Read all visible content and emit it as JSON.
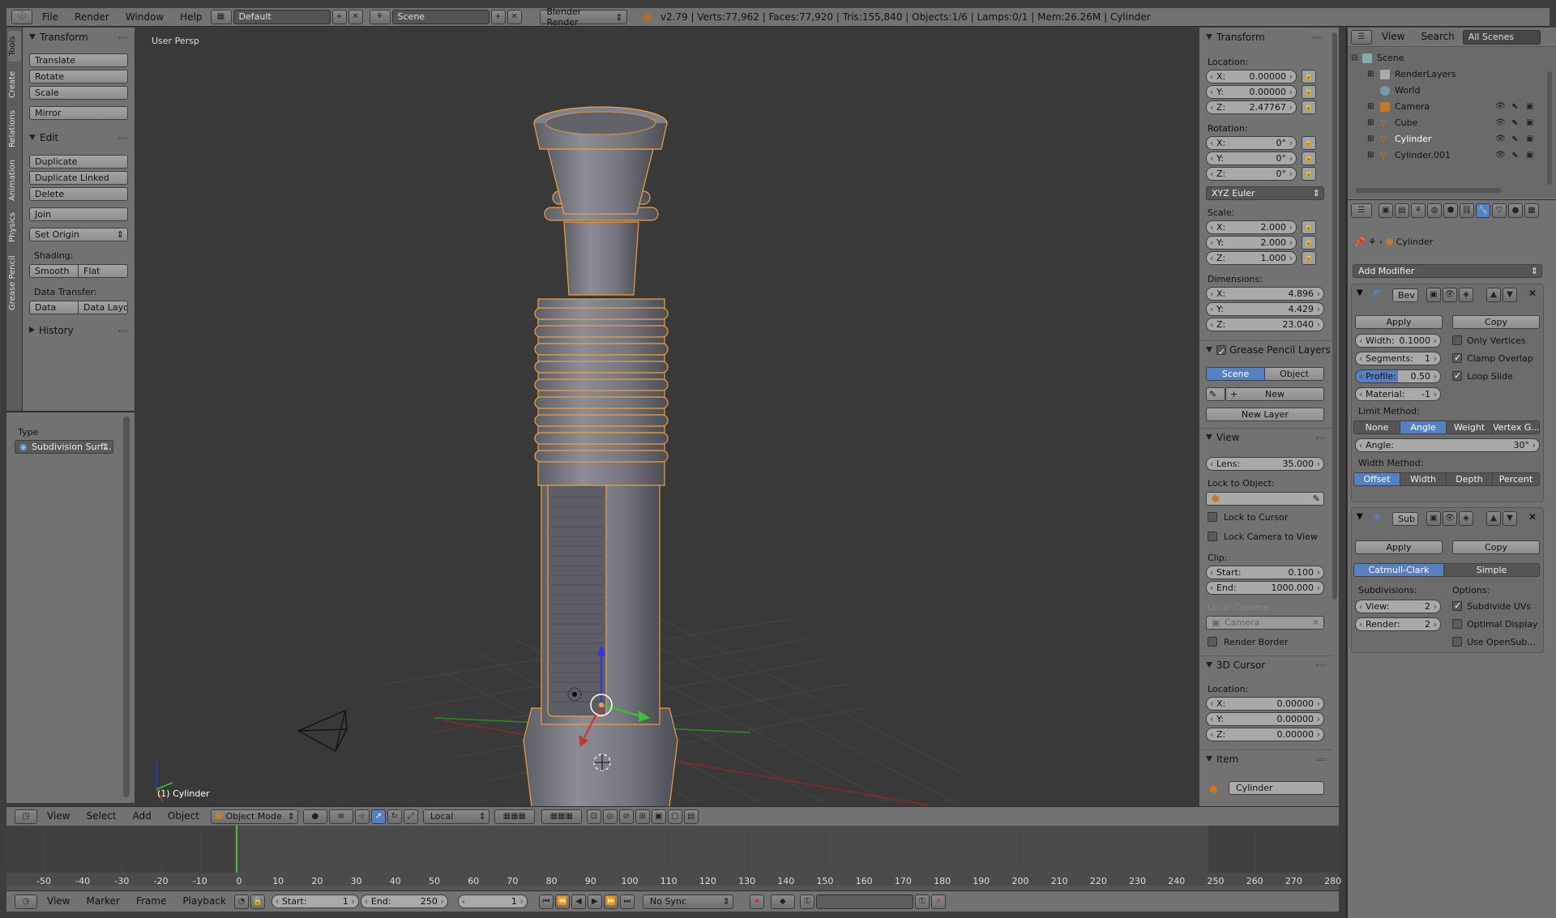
{
  "topbar": {
    "menus": [
      "File",
      "Render",
      "Window",
      "Help"
    ],
    "layout": "Default",
    "scene": "Scene",
    "engine": "Blender Render",
    "stats": "v2.79 | Verts:77,962 | Faces:77,920 | Tris:155,840 | Objects:1/6 | Lamps:0/1 | Mem:26.26M | Cylinder"
  },
  "vtabs": [
    "Tools",
    "Create",
    "Relations",
    "Animation",
    "Physics",
    "Grease Pencil"
  ],
  "tools": {
    "transform_title": "Transform",
    "translate": "Translate",
    "rotate": "Rotate",
    "scale": "Scale",
    "mirror": "Mirror",
    "edit_title": "Edit",
    "duplicate": "Duplicate",
    "duplicate_linked": "Duplicate Linked",
    "delete": "Delete",
    "join": "Join",
    "set_origin": "Set Origin",
    "shading_label": "Shading:",
    "smooth": "Smooth",
    "flat": "Flat",
    "data_transfer_label": "Data Transfer:",
    "data": "Data",
    "data_layout": "Data Layo",
    "history_title": "History"
  },
  "redo": {
    "type_label": "Type",
    "type_value": "Subdivision Surf..."
  },
  "viewport": {
    "view_name": "User Persp",
    "object_label": "(1) Cylinder"
  },
  "npanel": {
    "transform_title": "Transform",
    "location_label": "Location:",
    "loc": {
      "x": "0.00000",
      "y": "0.00000",
      "z": "2.47767"
    },
    "rotation_label": "Rotation:",
    "rot": {
      "x": "0°",
      "y": "0°",
      "z": "0°"
    },
    "rotation_mode": "XYZ Euler",
    "scale_label": "Scale:",
    "scl": {
      "x": "2.000",
      "y": "2.000",
      "z": "1.000"
    },
    "dimensions_label": "Dimensions:",
    "dim": {
      "x": "4.896",
      "y": "4.429",
      "z": "23.040"
    },
    "gp_title": "Grease Pencil Layers",
    "gp_scene": "Scene",
    "gp_object": "Object",
    "gp_new": "New",
    "gp_new_layer": "New Layer",
    "view_title": "View",
    "lens_label": "Lens:",
    "lens": "35.000",
    "lock_object_label": "Lock to Object:",
    "lock_cursor": "Lock to Cursor",
    "lock_camera": "Lock Camera to View",
    "clip_label": "Clip:",
    "clip_start_label": "Start:",
    "clip_start": "0.100",
    "clip_end_label": "End:",
    "clip_end": "1000.000",
    "local_camera_label": "Local Camera:",
    "local_camera": "Camera",
    "render_border": "Render Border",
    "cursor_title": "3D Cursor",
    "cursor_location_label": "Location:",
    "cursor": {
      "x": "0.00000",
      "y": "0.00000",
      "z": "0.00000"
    },
    "item_title": "Item",
    "item_name": "Cylinder",
    "axis_x": "X:",
    "axis_y": "Y:",
    "axis_z": "Z:"
  },
  "outliner": {
    "menus": [
      "View",
      "Search"
    ],
    "filter": "All Scenes",
    "rows": [
      "Scene",
      "RenderLayers",
      "World",
      "Camera",
      "Cube",
      "Cylinder",
      "Cylinder.001"
    ]
  },
  "properties": {
    "object_name": "Cylinder",
    "add_modifier": "Add Modifier",
    "bevel": {
      "name": "Bev",
      "apply": "Apply",
      "copy": "Copy",
      "width_label": "Width:",
      "width": "0.1000",
      "segments_label": "Segments:",
      "segments": "1",
      "profile_label": "Profile:",
      "profile": "0.50",
      "material_label": "Material:",
      "material": "-1",
      "only_vertices": "Only Vertices",
      "clamp_overlap": "Clamp Overlap",
      "loop_slide": "Loop Slide",
      "limit_method_label": "Limit Method:",
      "limit_methods": [
        "None",
        "Angle",
        "Weight",
        "Vertex G..."
      ],
      "angle_label": "Angle:",
      "angle": "30°",
      "width_method_label": "Width Method:",
      "width_methods": [
        "Offset",
        "Width",
        "Depth",
        "Percent"
      ]
    },
    "subsurf": {
      "name": "Sub",
      "apply": "Apply",
      "copy": "Copy",
      "catmull": "Catmull-Clark",
      "simple": "Simple",
      "subdivisions_label": "Subdivisions:",
      "view_label": "View:",
      "view": "2",
      "render_label": "Render:",
      "render": "2",
      "options_label": "Options:",
      "subdivide_uvs": "Subdivide UVs",
      "optimal_display": "Optimal Display",
      "use_opensubdiv": "Use OpenSub..."
    }
  },
  "view_header": {
    "menus": [
      "View",
      "Select",
      "Add",
      "Object"
    ],
    "mode": "Object Mode",
    "orientation": "Local"
  },
  "timeline": {
    "ticks": [
      "-50",
      "-40",
      "-30",
      "-20",
      "-10",
      "0",
      "10",
      "20",
      "30",
      "40",
      "50",
      "60",
      "70",
      "80",
      "90",
      "100",
      "110",
      "120",
      "130",
      "140",
      "150",
      "160",
      "170",
      "180",
      "190",
      "200",
      "210",
      "220",
      "230",
      "240",
      "250",
      "260",
      "270",
      "280"
    ],
    "menus": [
      "View",
      "Marker",
      "Frame",
      "Playback"
    ],
    "start_label": "Start:",
    "start": "1",
    "end_label": "End:",
    "end": "250",
    "current": "1",
    "sync": "No Sync"
  },
  "colors": {
    "accent": "#5680c2",
    "select_outline": "#f0a040",
    "x_axis": "#c83232",
    "y_axis": "#32c832",
    "z_axis": "#3232e6"
  }
}
